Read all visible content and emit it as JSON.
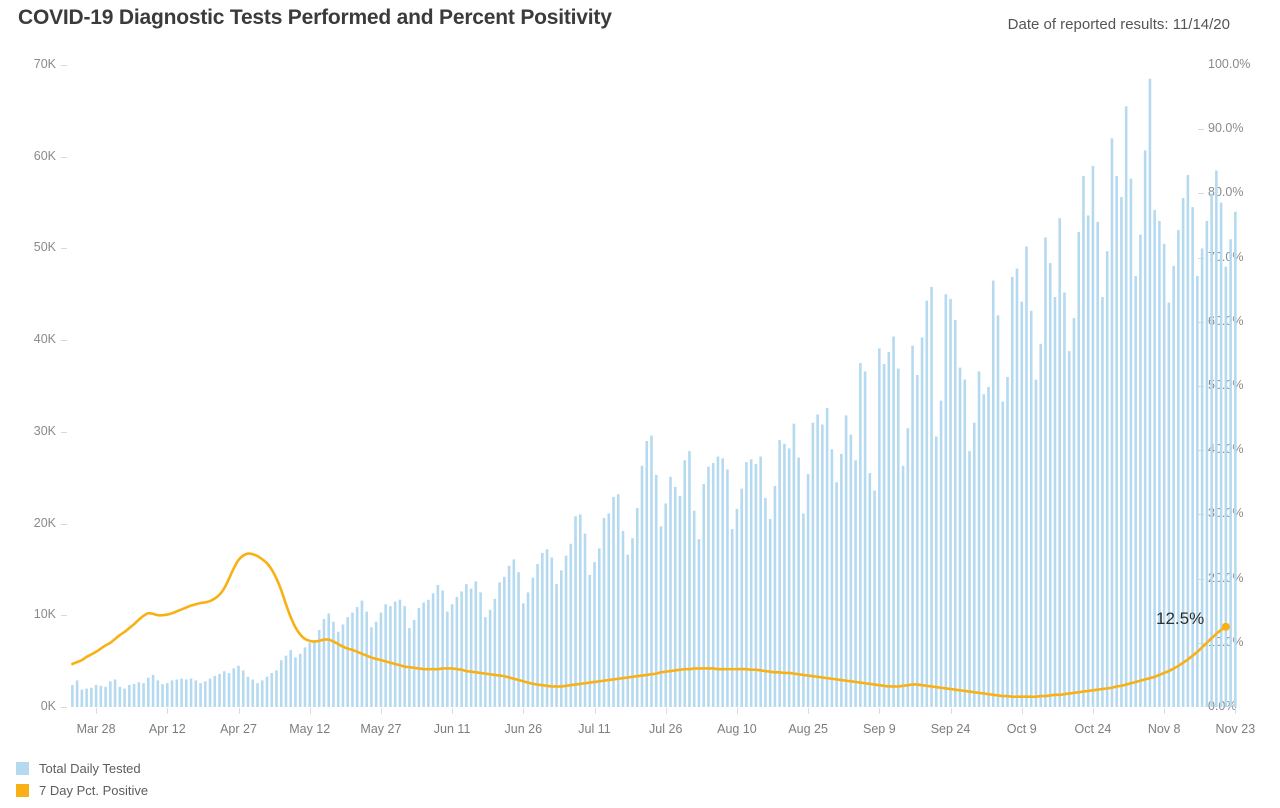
{
  "header": {
    "title": "COVID-19 Diagnostic Tests Performed and Percent Positivity",
    "subtitle": "Date of reported results: 11/14/20"
  },
  "legend": {
    "items": [
      {
        "label": "Total Daily Tested",
        "color": "#b5daf0",
        "type": "bar"
      },
      {
        "label": "7 Day Pct. Positive",
        "color": "#f9b014",
        "type": "line"
      }
    ]
  },
  "annotation": {
    "end_label": "12.5%"
  },
  "chart_data": {
    "type": "bar",
    "title": "COVID-19 Diagnostic Tests Performed and Percent Positivity",
    "subtitle": "Date of reported results: 11/14/20",
    "xlabel": "",
    "ylabel": "",
    "y_left": {
      "label": "Total Daily Tested",
      "ticks": [
        "0K",
        "10K",
        "20K",
        "30K",
        "40K",
        "50K",
        "60K",
        "70K"
      ],
      "tick_values": [
        0,
        10000,
        20000,
        30000,
        40000,
        50000,
        60000,
        70000
      ],
      "ylim": [
        0,
        70000
      ]
    },
    "y_right": {
      "label": "7 Day Pct. Positive",
      "ticks": [
        "0.0%",
        "10.0%",
        "20.0%",
        "30.0%",
        "40.0%",
        "50.0%",
        "60.0%",
        "70.0%",
        "80.0%",
        "90.0%",
        "100.0%"
      ],
      "tick_values": [
        0,
        10,
        20,
        30,
        40,
        50,
        60,
        70,
        80,
        90,
        100
      ],
      "ylim": [
        0,
        100
      ]
    },
    "x_tick_labels": [
      "Mar 28",
      "Apr 12",
      "Apr 27",
      "May 12",
      "May 27",
      "Jun 11",
      "Jun 26",
      "Jul 11",
      "Jul 26",
      "Aug 10",
      "Aug 25",
      "Sep 9",
      "Sep 24",
      "Oct 9",
      "Oct 24",
      "Nov 8",
      "Nov 23"
    ],
    "x_tick_indices": [
      5,
      20,
      35,
      50,
      65,
      80,
      95,
      110,
      125,
      140,
      155,
      170,
      185,
      200,
      215,
      230,
      245
    ],
    "start_date": "2020-03-23",
    "n_points": 237,
    "grid": false,
    "legend_position": "bottom-left",
    "series": [
      {
        "name": "Total Daily Tested",
        "axis": "left",
        "type": "bar",
        "color": "#b5daf0",
        "values": [
          2400,
          2900,
          1900,
          2000,
          2100,
          2400,
          2300,
          2200,
          2800,
          3000,
          2200,
          2000,
          2400,
          2500,
          2700,
          2600,
          3200,
          3500,
          2900,
          2500,
          2600,
          2900,
          3000,
          3100,
          3000,
          3100,
          2900,
          2600,
          2800,
          3100,
          3400,
          3600,
          3900,
          3700,
          4200,
          4500,
          4000,
          3300,
          3000,
          2600,
          2900,
          3300,
          3700,
          4000,
          5100,
          5600,
          6200,
          5400,
          5800,
          6500,
          7000,
          7300,
          8400,
          9600,
          10200,
          9300,
          8200,
          9000,
          9800,
          10300,
          10900,
          11600,
          10400,
          8700,
          9300,
          10300,
          11200,
          11000,
          11500,
          11700,
          11000,
          8600,
          9500,
          10800,
          11400,
          11700,
          12400,
          13300,
          12700,
          10400,
          11200,
          12000,
          12600,
          13400,
          12900,
          13700,
          12500,
          9800,
          10600,
          11800,
          13600,
          14200,
          15400,
          16100,
          14700,
          11300,
          12500,
          14100,
          15600,
          16800,
          17200,
          16300,
          13400,
          14900,
          16500,
          17800,
          20800,
          21000,
          18900,
          14400,
          15800,
          17300,
          20600,
          21100,
          22900,
          23200,
          19200,
          16600,
          18400,
          21700,
          26300,
          29000,
          29600,
          25300,
          19700,
          22200,
          25100,
          24000,
          23000,
          26900,
          27900,
          21400,
          18300,
          24300,
          26200,
          26600,
          27300,
          27100,
          25900,
          19400,
          21600,
          23800,
          26700,
          27000,
          26500,
          27300,
          22800,
          20500,
          24100,
          29100,
          28700,
          28200,
          30900,
          27200,
          21100,
          25400,
          31000,
          31900,
          30800,
          32600,
          28100,
          24500,
          27600,
          31800,
          29700,
          26900,
          37500,
          36600,
          25500,
          23600,
          39100,
          37400,
          38700,
          40400,
          36900,
          26300,
          30400,
          39400,
          36200,
          40300,
          44300,
          45800,
          29500,
          33400,
          45000,
          44500,
          42200,
          37000,
          35700,
          27900,
          31000,
          36600,
          34100,
          34900,
          46500,
          42700,
          33300,
          36000,
          46900,
          47800,
          44200,
          50200,
          43200,
          35700,
          39600,
          51200,
          48400,
          44700,
          53300,
          45200,
          38800,
          42400,
          51800,
          57900,
          53600,
          59000,
          52900,
          44700,
          49700,
          62000,
          57900,
          55600,
          65500,
          57600,
          47000,
          51500,
          60700,
          68500,
          54200,
          53000,
          50500,
          44100,
          48100,
          52000,
          55500,
          58000,
          54500,
          47000,
          50000,
          53000,
          56000,
          58500,
          55000,
          48000,
          51000,
          54000
        ]
      },
      {
        "name": "7 Day Pct. Positive",
        "axis": "right",
        "type": "line",
        "color": "#f9b014",
        "values": [
          6.7,
          7.0,
          7.3,
          7.8,
          8.2,
          8.6,
          9.1,
          9.6,
          10.0,
          10.6,
          11.2,
          11.7,
          12.3,
          12.9,
          13.6,
          14.2,
          14.6,
          14.5,
          14.3,
          14.3,
          14.4,
          14.6,
          14.9,
          15.2,
          15.5,
          15.8,
          16.0,
          16.2,
          16.3,
          16.5,
          16.9,
          17.5,
          18.5,
          20.0,
          21.6,
          22.9,
          23.6,
          23.9,
          23.8,
          23.5,
          23.0,
          22.4,
          21.4,
          20.0,
          18.2,
          16.0,
          14.0,
          12.4,
          11.3,
          10.6,
          10.3,
          10.2,
          10.3,
          10.5,
          10.5,
          10.2,
          9.8,
          9.4,
          9.1,
          8.9,
          8.6,
          8.3,
          8.0,
          7.7,
          7.5,
          7.3,
          7.1,
          6.9,
          6.7,
          6.5,
          6.3,
          6.2,
          6.1,
          6.0,
          5.9,
          5.9,
          5.9,
          5.9,
          6.0,
          6.0,
          6.0,
          5.9,
          5.8,
          5.6,
          5.5,
          5.4,
          5.3,
          5.2,
          5.1,
          5.0,
          4.9,
          4.8,
          4.6,
          4.4,
          4.2,
          4.0,
          3.8,
          3.6,
          3.5,
          3.4,
          3.3,
          3.2,
          3.2,
          3.2,
          3.3,
          3.4,
          3.5,
          3.6,
          3.7,
          3.8,
          3.9,
          4.0,
          4.1,
          4.2,
          4.3,
          4.4,
          4.5,
          4.6,
          4.7,
          4.8,
          4.9,
          5.0,
          5.1,
          5.2,
          5.4,
          5.5,
          5.6,
          5.7,
          5.8,
          5.9,
          5.9,
          6.0,
          6.0,
          6.0,
          6.0,
          6.0,
          5.9,
          5.9,
          5.9,
          5.9,
          5.9,
          5.9,
          5.9,
          5.8,
          5.8,
          5.7,
          5.6,
          5.5,
          5.4,
          5.4,
          5.3,
          5.3,
          5.2,
          5.1,
          5.0,
          4.9,
          4.8,
          4.7,
          4.6,
          4.5,
          4.4,
          4.3,
          4.2,
          4.1,
          4.0,
          3.9,
          3.8,
          3.7,
          3.6,
          3.5,
          3.4,
          3.3,
          3.2,
          3.2,
          3.2,
          3.3,
          3.4,
          3.5,
          3.5,
          3.4,
          3.3,
          3.2,
          3.1,
          3.0,
          2.9,
          2.8,
          2.7,
          2.6,
          2.5,
          2.4,
          2.3,
          2.2,
          2.1,
          2.0,
          1.9,
          1.8,
          1.7,
          1.7,
          1.6,
          1.6,
          1.6,
          1.6,
          1.6,
          1.6,
          1.7,
          1.7,
          1.8,
          1.9,
          1.9,
          2.0,
          2.1,
          2.2,
          2.3,
          2.4,
          2.5,
          2.6,
          2.7,
          2.8,
          2.9,
          3.0,
          3.2,
          3.3,
          3.5,
          3.7,
          3.9,
          4.1,
          4.3,
          4.5,
          4.7,
          5.0,
          5.3,
          5.6,
          6.0,
          6.4,
          6.9,
          7.4,
          8.0,
          8.6,
          9.3,
          10.0,
          10.7,
          11.4,
          12.0,
          12.5
        ]
      }
    ]
  }
}
